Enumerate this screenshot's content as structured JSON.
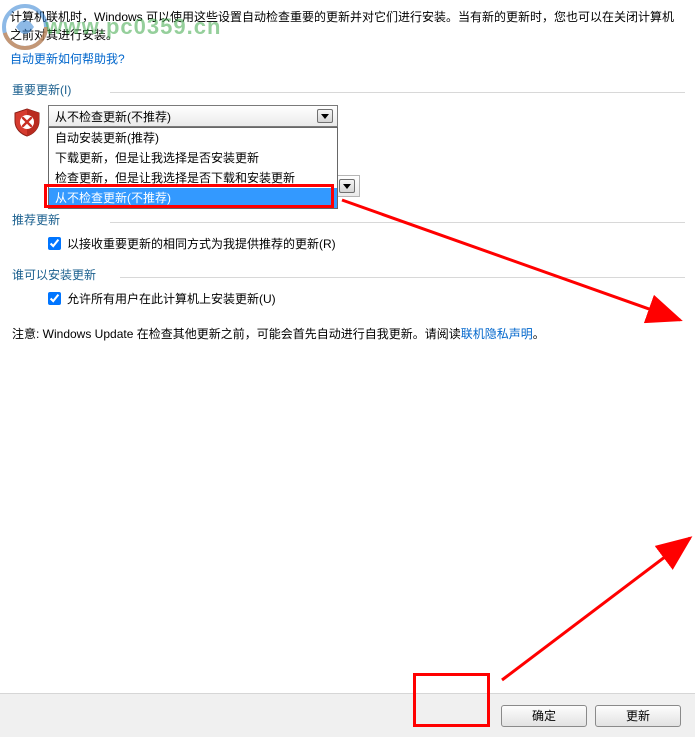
{
  "watermark": {
    "text": "www.pc0359.cn"
  },
  "intro": {
    "line1": "计算机联机时，Windows 可以使用这些设置自动检查重要的更新并对它们进行安装。当有新的更新时，您也可以在关闭计算机之前对其进行安装。",
    "helpLink": "自动更新如何帮助我?"
  },
  "important": {
    "legend": "重要更新(I)",
    "selected": "从不检查更新(不推荐)",
    "options": [
      "自动安装更新(推荐)",
      "下载更新，但是让我选择是否安装更新",
      "检查更新，但是让我选择是否下载和安装更新",
      "从不检查更新(不推荐)"
    ]
  },
  "recommended": {
    "legend": "推荐更新",
    "checkboxLabel": "以接收重要更新的相同方式为我提供推荐的更新(R)"
  },
  "who": {
    "legend": "谁可以安装更新",
    "checkboxLabel": "允许所有用户在此计算机上安装更新(U)"
  },
  "note": {
    "prefix": "注意: Windows Update 在检查其他更新之前，可能会首先自动进行自我更新。请阅读",
    "link": "联机隐私声明",
    "suffix": "。"
  },
  "buttons": {
    "ok": "确定",
    "cancel": "更新"
  }
}
